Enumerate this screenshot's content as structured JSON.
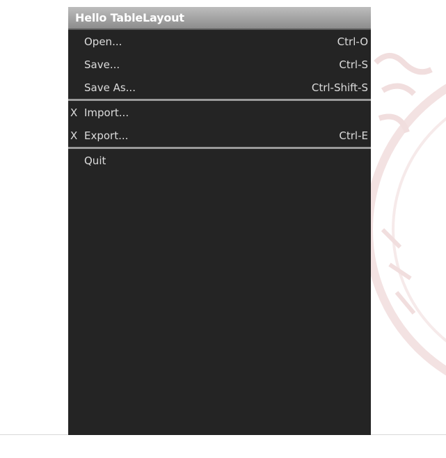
{
  "window": {
    "title": "Hello TableLayout"
  },
  "menu": {
    "items": [
      {
        "mark": "",
        "label": "Open...",
        "shortcut": "Ctrl-O"
      },
      {
        "mark": "",
        "label": "Save...",
        "shortcut": "Ctrl-S"
      },
      {
        "mark": "",
        "label": "Save As...",
        "shortcut": "Ctrl-Shift-S"
      },
      {
        "mark": "X",
        "label": "Import...",
        "shortcut": ""
      },
      {
        "mark": "X",
        "label": "Export...",
        "shortcut": "Ctrl-E"
      },
      {
        "mark": "",
        "label": "Quit",
        "shortcut": ""
      }
    ]
  },
  "colors": {
    "screen_bg": "#242424",
    "title_bg": "#a6a6a6",
    "text": "#dcdcdc",
    "divider": "#9a9a9a"
  }
}
